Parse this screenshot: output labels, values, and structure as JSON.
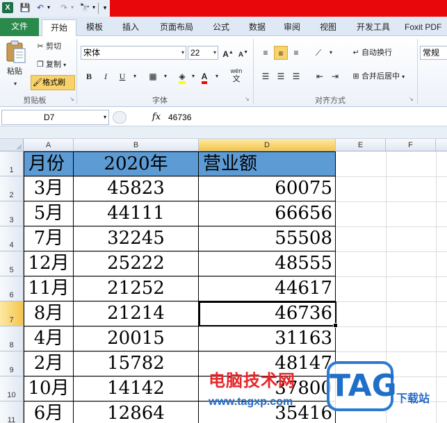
{
  "qat": {
    "app_icon": "X",
    "save_icon": "💾",
    "undo_icon": "↶",
    "redo_icon": "↷",
    "find_icon": "🔭",
    "dd": "▾"
  },
  "tabs": [
    "文件",
    "开始",
    "模板",
    "插入",
    "页面布局",
    "公式",
    "数据",
    "审阅",
    "视图",
    "开发工具",
    "Foxit PDF"
  ],
  "ribbon": {
    "clipboard": {
      "paste": "粘贴",
      "cut": "剪切",
      "copy": "复制",
      "format_painter": "格式刷",
      "group_label": "剪贴板"
    },
    "font": {
      "font_name": "宋体",
      "font_size": "22",
      "bold": "B",
      "italic": "I",
      "underline": "U",
      "grow": "A",
      "shrink": "A",
      "font_color": "A",
      "phonetic": "wén",
      "group_label": "字体"
    },
    "alignment": {
      "wrap_text": "自动换行",
      "merge_center": "合并后居中",
      "group_label": "对齐方式"
    },
    "number": {
      "format": "常规"
    }
  },
  "formula_bar": {
    "name_box": "D7",
    "fx": "fx",
    "value": "46736"
  },
  "columns": [
    "A",
    "B",
    "D",
    "E",
    "F"
  ],
  "rows": [
    "1",
    "2",
    "3",
    "4",
    "5",
    "6",
    "7",
    "8",
    "9",
    "10",
    "11"
  ],
  "table": {
    "headers": [
      "月份",
      "2020年",
      "营业额"
    ],
    "data": [
      [
        "3月",
        "45823",
        "60075"
      ],
      [
        "5月",
        "44111",
        "66656"
      ],
      [
        "7月",
        "32245",
        "55508"
      ],
      [
        "12月",
        "25222",
        "48555"
      ],
      [
        "11月",
        "21252",
        "44617"
      ],
      [
        "8月",
        "21214",
        "46736"
      ],
      [
        "4月",
        "20015",
        "31163"
      ],
      [
        "2月",
        "15782",
        "48147"
      ],
      [
        "10月",
        "14142",
        "37800"
      ],
      [
        "6月",
        "12864",
        "35416"
      ]
    ]
  },
  "watermark": {
    "site_name": "电脑技术网",
    "url": "www.tagxp.com",
    "logo": "TAG",
    "download": "下载站"
  }
}
